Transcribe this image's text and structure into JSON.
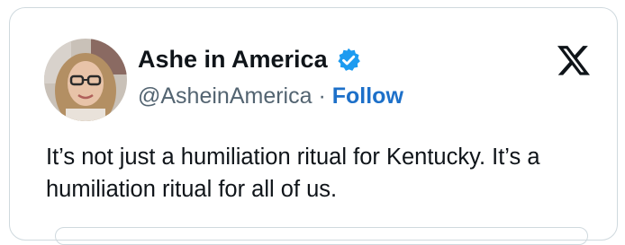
{
  "author": {
    "display_name": "Ashe in America",
    "handle": "@AsheinAmerica",
    "separator": "·",
    "follow_label": "Follow",
    "verified": true,
    "verified_color": "#1d9bf0"
  },
  "tweet": {
    "text": "It’s not just a humiliation ritual for Kentucky. It’s a humiliation ritual for all of us."
  },
  "icons": {
    "brand": "x-logo-icon",
    "verified": "verified-badge-icon"
  },
  "colors": {
    "text": "#0f1419",
    "muted": "#536471",
    "link": "#1d70c9",
    "border": "#cfd9de"
  }
}
